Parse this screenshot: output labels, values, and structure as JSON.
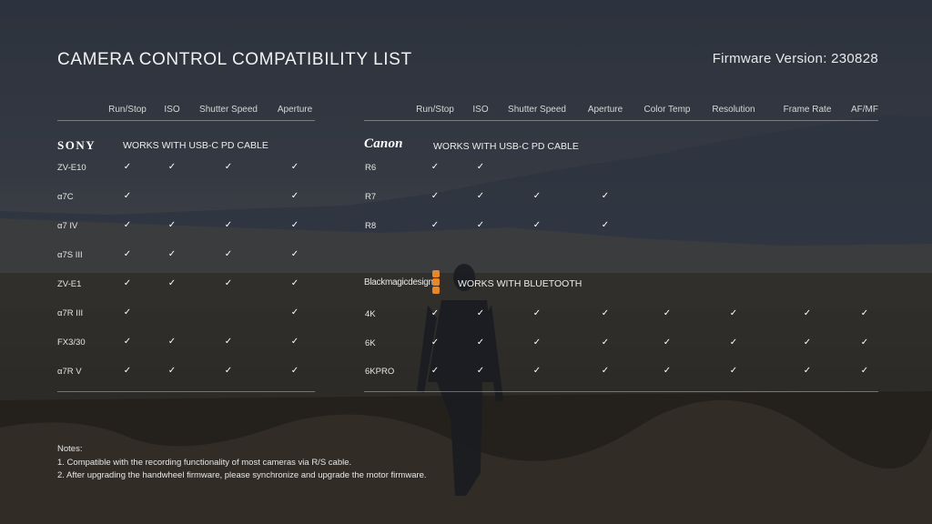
{
  "title": "CAMERA CONTROL COMPATIBILITY LIST",
  "firmware": "Firmware Version: 230828",
  "check_symbol": "✓",
  "sony": {
    "logo": "SONY",
    "note": "WORKS WITH USB-C PD CABLE",
    "columns": [
      "Run/Stop",
      "ISO",
      "Shutter Speed",
      "Aperture"
    ],
    "rows": [
      {
        "model": "ZV-E10",
        "checks": [
          true,
          true,
          true,
          true
        ]
      },
      {
        "model": "α7C",
        "checks": [
          true,
          false,
          false,
          true
        ]
      },
      {
        "model": "α7 IV",
        "checks": [
          true,
          true,
          true,
          true
        ]
      },
      {
        "model": "α7S III",
        "checks": [
          true,
          true,
          true,
          true
        ]
      },
      {
        "model": "ZV-E1",
        "checks": [
          true,
          true,
          true,
          true
        ]
      },
      {
        "model": "α7R III",
        "checks": [
          true,
          false,
          false,
          true
        ]
      },
      {
        "model": "FX3/30",
        "checks": [
          true,
          true,
          true,
          true
        ]
      },
      {
        "model": "α7R V",
        "checks": [
          true,
          true,
          true,
          true
        ]
      }
    ]
  },
  "canon": {
    "logo": "Canon",
    "note": "WORKS WITH USB-C PD CABLE",
    "rows": [
      {
        "model": "R6",
        "checks": [
          true,
          true,
          false,
          false,
          false,
          false,
          false,
          false
        ]
      },
      {
        "model": "R7",
        "checks": [
          true,
          true,
          true,
          true,
          false,
          false,
          false,
          false
        ]
      },
      {
        "model": "R8",
        "checks": [
          true,
          true,
          true,
          true,
          false,
          false,
          false,
          false
        ]
      }
    ]
  },
  "right_columns": [
    "Run/Stop",
    "ISO",
    "Shutter Speed",
    "Aperture",
    "Color Temp",
    "Resolution",
    "Frame Rate",
    "AF/MF"
  ],
  "blackmagic": {
    "logo": "Blackmagicdesign",
    "note": "WORKS WITH BLUETOOTH",
    "rows": [
      {
        "model": "4K",
        "checks": [
          true,
          true,
          true,
          true,
          true,
          true,
          true,
          true
        ]
      },
      {
        "model": "6K",
        "checks": [
          true,
          true,
          true,
          true,
          true,
          true,
          true,
          true
        ]
      },
      {
        "model": "6KPRO",
        "checks": [
          true,
          true,
          true,
          true,
          true,
          true,
          true,
          true
        ]
      }
    ]
  },
  "notes": {
    "heading": "Notes:",
    "lines": [
      "1. Compatible with the recording functionality of most cameras via R/S cable.",
      "2. After upgrading the handwheel firmware, please synchronize and upgrade the motor firmware."
    ]
  }
}
